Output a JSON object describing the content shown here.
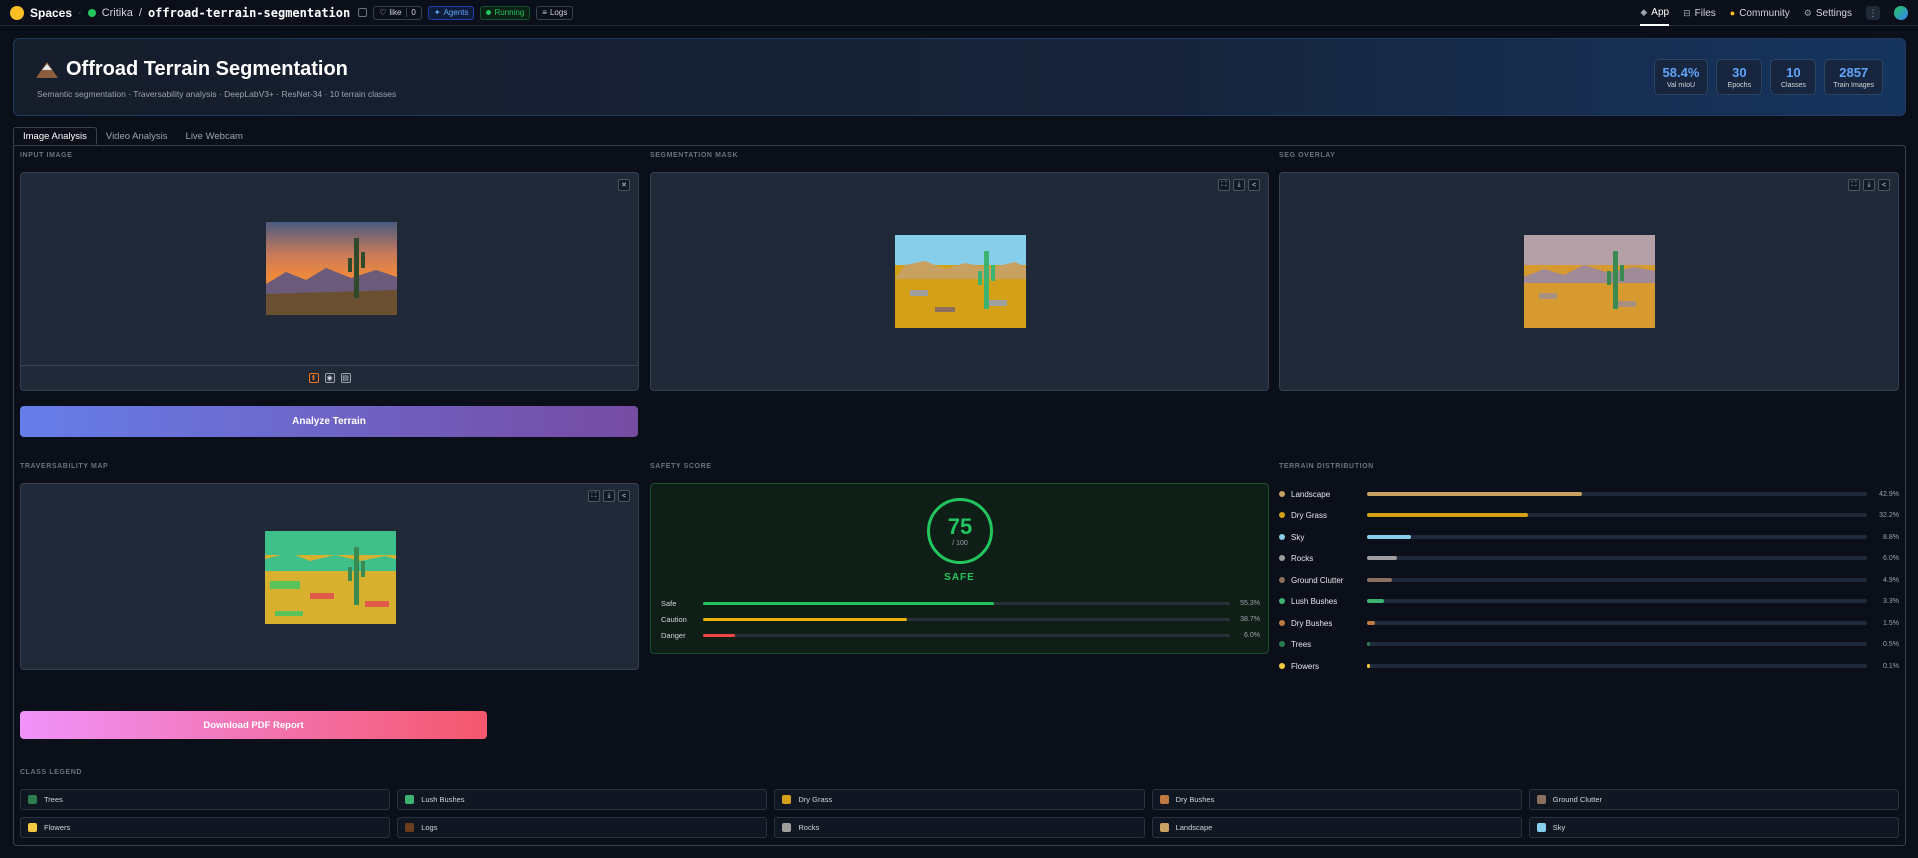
{
  "topbar": {
    "spaces_label": "Spaces",
    "owner": "Critika",
    "slash": "/",
    "repo": "offroad-terrain-segmentation",
    "like_label": "like",
    "like_count": "0",
    "agents_label": "Agents",
    "running_label": "Running",
    "logs_label": "Logs",
    "nav": [
      {
        "label": "App",
        "icon": "app-icon"
      },
      {
        "label": "Files",
        "icon": "files-icon"
      },
      {
        "label": "Community",
        "icon": "community-icon"
      },
      {
        "label": "Settings",
        "icon": "gear-icon"
      }
    ]
  },
  "header": {
    "title": "Offroad Terrain Segmentation",
    "subtitle": "Semantic segmentation · Traversability analysis · DeepLabV3+ · ResNet-34 · 10 terrain classes",
    "stats": [
      {
        "value": "58.4%",
        "label": "Val mIoU"
      },
      {
        "value": "30",
        "label": "Epochs"
      },
      {
        "value": "10",
        "label": "Classes"
      },
      {
        "value": "2857",
        "label": "Train Images"
      }
    ]
  },
  "tabs": [
    "Image Analysis",
    "Video Analysis",
    "Live Webcam"
  ],
  "sections": {
    "input": "INPUT IMAGE",
    "mask": "SEGMENTATION MASK",
    "overlay": "SEG OVERLAY",
    "trav": "TRAVERSABILITY MAP",
    "safety": "SAFETY SCORE",
    "dist": "TERRAIN DISTRIBUTION",
    "legend": "CLASS LEGEND"
  },
  "analyze_label": "Analyze Terrain",
  "pdf_label": "Download PDF Report",
  "safety": {
    "score": "75",
    "max": "/ 100",
    "status": "SAFE",
    "rows": [
      {
        "label": "Safe",
        "pct": "55.3%",
        "value": 55.3,
        "color": "#22c55e"
      },
      {
        "label": "Caution",
        "pct": "38.7%",
        "value": 38.7,
        "color": "#eab308"
      },
      {
        "label": "Danger",
        "pct": "6.0%",
        "value": 6.0,
        "color": "#ef4444"
      }
    ]
  },
  "distribution": [
    {
      "name": "Landscape",
      "pct": "42.9%",
      "value": 42.9,
      "color": "#c8a060"
    },
    {
      "name": "Dry Grass",
      "pct": "32.2%",
      "value": 32.2,
      "color": "#d4a017"
    },
    {
      "name": "Sky",
      "pct": "8.8%",
      "value": 8.8,
      "color": "#87ceeb"
    },
    {
      "name": "Rocks",
      "pct": "6.0%",
      "value": 6.0,
      "color": "#9e9e9e"
    },
    {
      "name": "Ground Clutter",
      "pct": "4.9%",
      "value": 4.9,
      "color": "#8b7060"
    },
    {
      "name": "Lush Bushes",
      "pct": "3.3%",
      "value": 3.3,
      "color": "#3cb371"
    },
    {
      "name": "Dry Bushes",
      "pct": "1.5%",
      "value": 1.5,
      "color": "#c07a40"
    },
    {
      "name": "Trees",
      "pct": "0.5%",
      "value": 0.5,
      "color": "#2e7d4f"
    },
    {
      "name": "Flowers",
      "pct": "0.1%",
      "value": 0.1,
      "color": "#f5c842"
    }
  ],
  "legend": [
    {
      "name": "Trees",
      "color": "#2e7d4f"
    },
    {
      "name": "Lush Bushes",
      "color": "#3cb371"
    },
    {
      "name": "Dry Grass",
      "color": "#d4a017"
    },
    {
      "name": "Dry Bushes",
      "color": "#c07a40"
    },
    {
      "name": "Ground Clutter",
      "color": "#8b7060"
    },
    {
      "name": "Flowers",
      "color": "#f5c842"
    },
    {
      "name": "Logs",
      "color": "#6b3e1f"
    },
    {
      "name": "Rocks",
      "color": "#9e9e9e"
    },
    {
      "name": "Landscape",
      "color": "#c8a060"
    },
    {
      "name": "Sky",
      "color": "#87ceeb"
    }
  ]
}
